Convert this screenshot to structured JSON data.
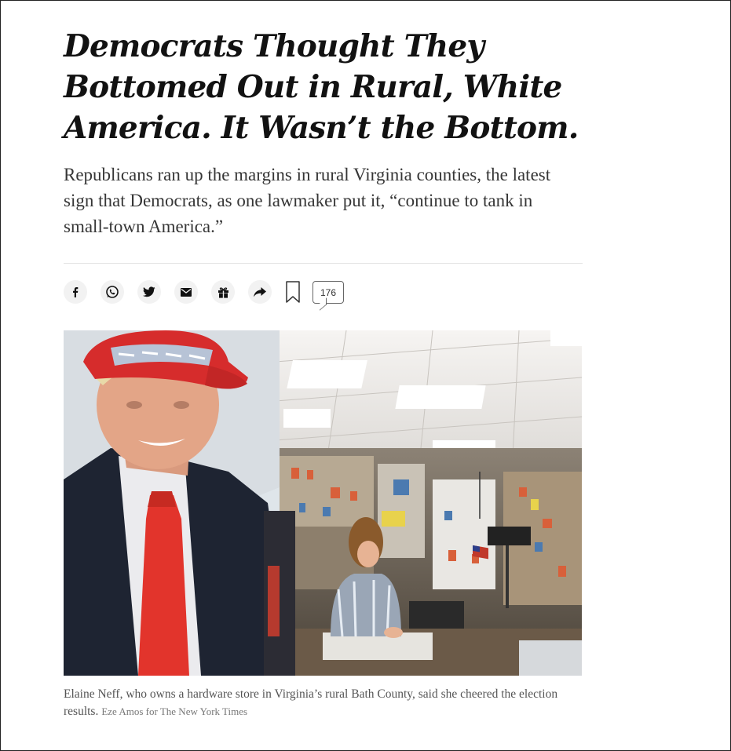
{
  "article": {
    "headline": "Democrats Thought They Bottomed Out in Rural, White America. It Wasn’t the Bottom.",
    "summary": "Republicans ran up the margins in rural Virginia counties, the latest sign that Democrats, as one lawmaker put it, “continue to tank in small-town America.”",
    "comment_count": "176",
    "caption": "Elaine Neff, who owns a hardware store in Virginia’s rural Bath County, said she cheered the election results.",
    "credit": "Eze Amos for The New York Times"
  },
  "share_icons": [
    "facebook-icon",
    "whatsapp-icon",
    "twitter-icon",
    "email-icon",
    "gift-icon",
    "share-arrow-icon",
    "bookmark-icon",
    "comment-icon"
  ],
  "colors": {
    "headline": "#121212",
    "summary": "#363636",
    "caption": "#555555",
    "icon_bg": "#f2f2f2"
  }
}
